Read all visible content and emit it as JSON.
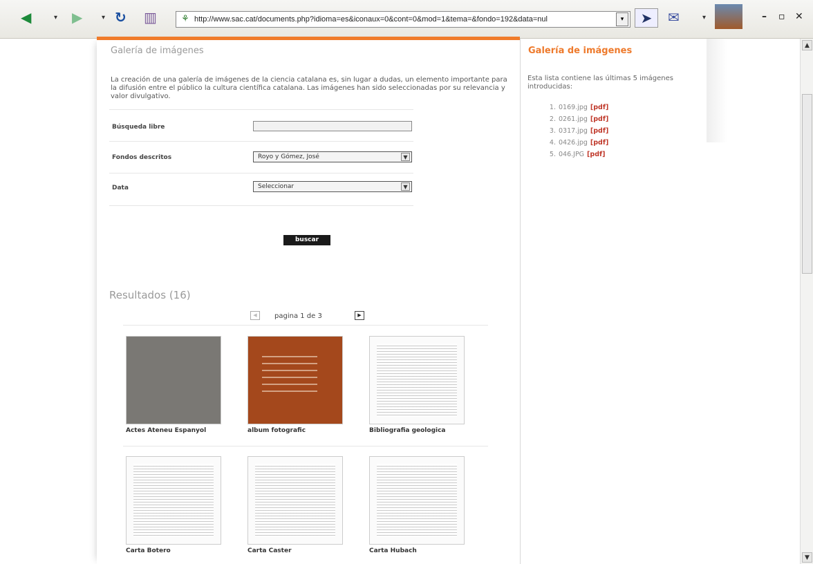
{
  "browser": {
    "url": "http://www.sac.cat/documents.php?idioma=es&iconaux=0&cont=0&mod=1&tema=&fondo=192&data=nul"
  },
  "main": {
    "title": "Galería de imágenes",
    "intro": "La creación de una galería de imágenes de la ciencia catalana es, sin lugar a dudas, un elemento importante para la difusión entre el público la cultura científica catalana. Las imágenes han sido seleccionadas por su relevancia y valor divulgativo.",
    "form": {
      "free_search_label": "Búsqueda libre",
      "free_search_value": "",
      "funds_label": "Fondos descritos",
      "funds_value": "Royo y Gómez, José",
      "date_label": "Data",
      "date_value": "Seleccionar"
    },
    "search_button": "buscar",
    "results_title": "Resultados (16)",
    "pager_text": "pagina 1 de 3",
    "gallery": [
      {
        "caption": "Actes Ateneu Espanyol",
        "style": "gray"
      },
      {
        "caption": "album fotografic",
        "style": "brown"
      },
      {
        "caption": "Bibliografia geologica",
        "style": "doc"
      },
      {
        "caption": "Carta Botero",
        "style": "doc"
      },
      {
        "caption": "Carta Caster",
        "style": "doc"
      },
      {
        "caption": "Carta Hubach",
        "style": "doc"
      }
    ]
  },
  "sidebar": {
    "title": "Galería de imágenes",
    "text": "Esta lista contiene las últimas 5 imágenes introducidas:",
    "items": [
      {
        "num": "1.",
        "file": "0169.jpg",
        "pdf": "[pdf]"
      },
      {
        "num": "2.",
        "file": "0261.jpg",
        "pdf": "[pdf]"
      },
      {
        "num": "3.",
        "file": "0317.jpg",
        "pdf": "[pdf]"
      },
      {
        "num": "4.",
        "file": "0426.jpg",
        "pdf": "[pdf]"
      },
      {
        "num": "5.",
        "file": "046.JPG",
        "pdf": "[pdf]"
      }
    ]
  },
  "colors": {
    "accent": "#ee7a2c",
    "pdf": "#c0392b"
  }
}
